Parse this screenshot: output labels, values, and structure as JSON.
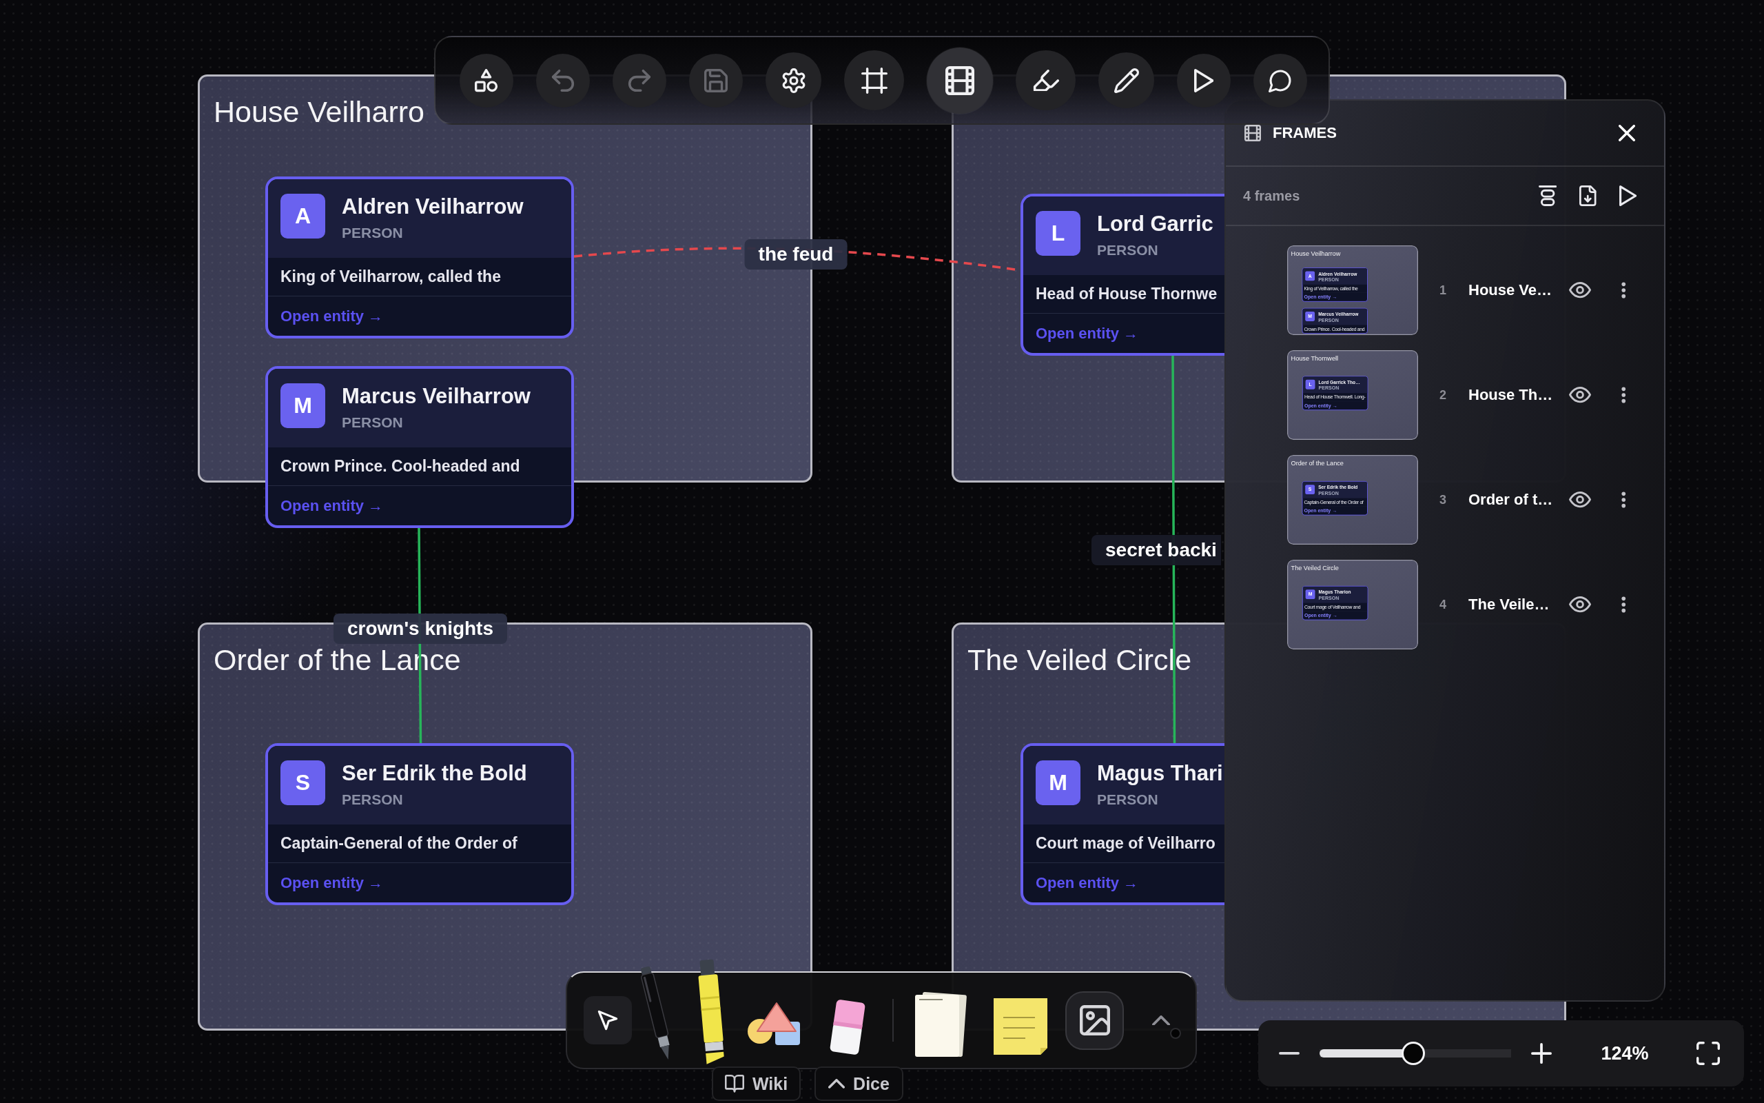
{
  "toolbar": {
    "tools": [
      {
        "kind": "shapes",
        "selected": false,
        "disabled": false
      },
      {
        "kind": "undo",
        "selected": false,
        "disabled": true
      },
      {
        "kind": "redo",
        "selected": false,
        "disabled": true
      },
      {
        "kind": "save",
        "selected": false,
        "disabled": true
      },
      {
        "kind": "settings",
        "selected": false,
        "disabled": false
      },
      {
        "kind": "frame",
        "selected": false,
        "disabled": false
      },
      {
        "kind": "frames",
        "selected": true,
        "disabled": false
      },
      {
        "kind": "highlighter",
        "selected": false,
        "disabled": false
      },
      {
        "kind": "pencil",
        "selected": false,
        "disabled": false
      },
      {
        "kind": "present",
        "selected": false,
        "disabled": false
      },
      {
        "kind": "comment",
        "selected": false,
        "disabled": false
      }
    ]
  },
  "canvas": {
    "frames": [
      {
        "title": "House Veilharro",
        "cards": [
          {
            "initial": "A",
            "name": "Aldren Veilharrow",
            "type": "PERSON",
            "description": "King of Veilharrow, called the",
            "link": "Open entity →"
          },
          {
            "initial": "M",
            "name": "Marcus Veilharrow",
            "type": "PERSON",
            "description": "Crown Prince. Cool-headed and",
            "link": "Open entity →"
          }
        ]
      },
      {
        "cards": [
          {
            "initial": "L",
            "name": "Lord Garric",
            "type": "PERSON",
            "description": "Head of House Thornwe",
            "link": "Open entity →"
          }
        ]
      },
      {
        "title": "Order of the Lance",
        "cards": [
          {
            "initial": "S",
            "name": "Ser Edrik the Bold",
            "type": "PERSON",
            "description": "Captain-General of the Order of",
            "link": "Open entity →"
          }
        ]
      },
      {
        "title": "The Veiled Circle",
        "cards": [
          {
            "initial": "M",
            "name": "Magus Thari",
            "type": "PERSON",
            "description": "Court mage of Veilharro",
            "link": "Open entity →"
          }
        ]
      }
    ],
    "connections": [
      {
        "kind": "dashed",
        "color": "#e5484d",
        "label": "the feud"
      },
      {
        "kind": "solid",
        "color": "#27b55a",
        "label": "crown's knights"
      },
      {
        "kind": "solid",
        "color": "#27b55a",
        "label": "secret backi"
      }
    ]
  },
  "frames_panel": {
    "title": "FRAMES",
    "count": "4 frames",
    "items": [
      {
        "number": "1",
        "name": "House Ve…",
        "thumbnail": {
          "title": "House Veilharrow",
          "cards": [
            {
              "initial": "A",
              "name": "Aldren Veilharrow",
              "type": "PERSON",
              "description": "King of Veilharrow, called the",
              "link": "Open entity →"
            },
            {
              "initial": "M",
              "name": "Marcus Veilharrow",
              "type": "PERSON",
              "description": "Crown Prince. Cool-headed and"
            }
          ]
        }
      },
      {
        "number": "2",
        "name": "House Th…",
        "thumbnail": {
          "title": "House Thornwell",
          "cards": [
            {
              "initial": "L",
              "name": "Lord Garrick Tho…",
              "type": "PERSON",
              "description": "Head of House Thornwell. Long-",
              "link": "Open entity →"
            }
          ]
        }
      },
      {
        "number": "3",
        "name": "Order of t…",
        "thumbnail": {
          "title": "Order of the Lance",
          "cards": [
            {
              "initial": "S",
              "name": "Ser Edrik the Bold",
              "type": "PERSON",
              "description": "Captain-General of the Order of",
              "link": "Open entity →"
            }
          ]
        }
      },
      {
        "number": "4",
        "name": "The Veile…",
        "thumbnail": {
          "title": "The Veiled Circle",
          "cards": [
            {
              "initial": "M",
              "name": "Magus Tharion",
              "type": "PERSON",
              "description": "Court mage of Veilharrow and",
              "link": "Open entity →"
            }
          ]
        }
      }
    ]
  },
  "drawing_toolbar": {
    "tools": [
      {
        "kind": "pointer",
        "selected": true
      },
      {
        "kind": "pen",
        "selected": false
      },
      {
        "kind": "highlighter",
        "selected": false
      },
      {
        "kind": "shapes",
        "selected": false
      },
      {
        "kind": "eraser",
        "selected": false
      }
    ],
    "inserts": [
      {
        "kind": "paper"
      },
      {
        "kind": "sticky-note"
      },
      {
        "kind": "image"
      }
    ]
  },
  "bottom_tabs": [
    {
      "kind": "wiki",
      "label": "Wiki"
    },
    {
      "kind": "dice",
      "label": "Dice"
    }
  ],
  "zoom": {
    "level": 0.49,
    "reading": "124%"
  }
}
